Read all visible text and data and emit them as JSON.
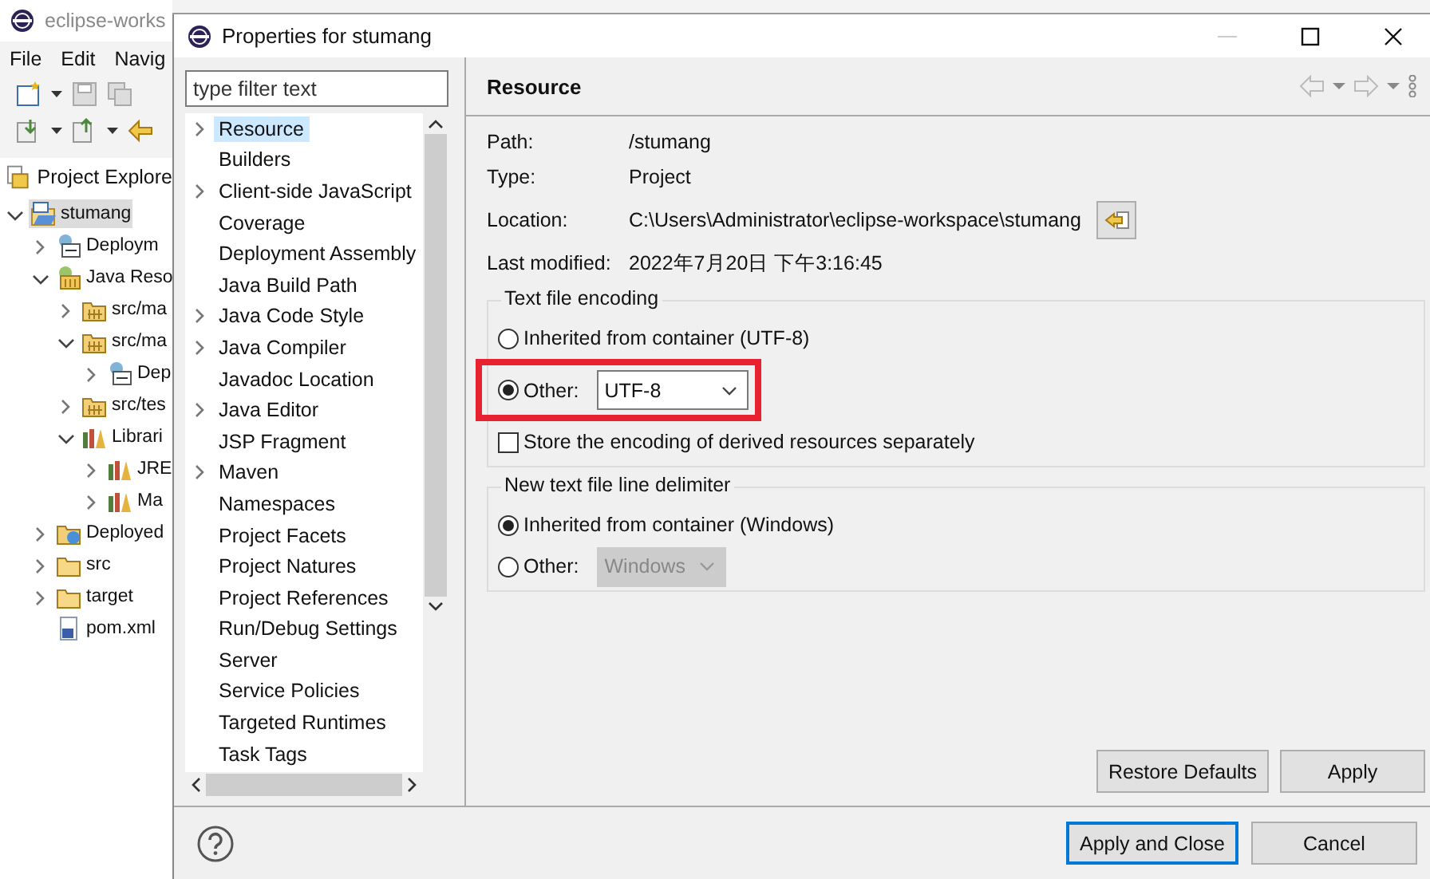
{
  "background_window": {
    "title": "eclipse-works",
    "menu": [
      "File",
      "Edit",
      "Navig"
    ],
    "view_tab": "Project Explore",
    "tree": [
      {
        "label": "stumang",
        "kind": "project",
        "expandable": true,
        "expanded": true,
        "selected": true,
        "children": [
          {
            "label": "Deploym",
            "kind": "descriptor",
            "expandable": true,
            "expanded": false,
            "selected": false
          },
          {
            "label": "Java Reso",
            "kind": "java-resources",
            "expandable": true,
            "expanded": true,
            "selected": false,
            "children": [
              {
                "label": "src/ma",
                "kind": "source-folder",
                "expandable": true,
                "expanded": false,
                "selected": false
              },
              {
                "label": "src/ma",
                "kind": "source-folder",
                "expandable": true,
                "expanded": true,
                "selected": false,
                "children": [
                  {
                    "label": "Dep",
                    "kind": "descriptor",
                    "expandable": true,
                    "expanded": false,
                    "selected": false
                  }
                ]
              },
              {
                "label": "src/tes",
                "kind": "source-folder",
                "expandable": true,
                "expanded": false,
                "selected": false
              },
              {
                "label": "Librari",
                "kind": "library",
                "expandable": true,
                "expanded": true,
                "selected": false,
                "children": [
                  {
                    "label": "JRE",
                    "kind": "library",
                    "expandable": true,
                    "expanded": false,
                    "selected": false
                  },
                  {
                    "label": "Ma",
                    "kind": "library",
                    "expandable": true,
                    "expanded": false,
                    "selected": false
                  }
                ]
              }
            ]
          },
          {
            "label": "Deployed",
            "kind": "web-deployed",
            "expandable": true,
            "expanded": false,
            "selected": false
          },
          {
            "label": "src",
            "kind": "folder",
            "expandable": true,
            "expanded": false,
            "selected": false
          },
          {
            "label": "target",
            "kind": "folder",
            "expandable": true,
            "expanded": false,
            "selected": false
          },
          {
            "label": "pom.xml",
            "kind": "xml-file",
            "expandable": false,
            "expanded": false,
            "selected": false
          }
        ]
      }
    ]
  },
  "dialog": {
    "title": "Properties for stumang",
    "filter": {
      "placeholder": "type filter text"
    },
    "pages": [
      {
        "label": "Resource",
        "expandable": true,
        "selected": true
      },
      {
        "label": "Builders",
        "expandable": false,
        "selected": false
      },
      {
        "label": "Client-side JavaScript",
        "expandable": true,
        "selected": false
      },
      {
        "label": "Coverage",
        "expandable": false,
        "selected": false
      },
      {
        "label": "Deployment Assembly",
        "expandable": false,
        "selected": false
      },
      {
        "label": "Java Build Path",
        "expandable": false,
        "selected": false
      },
      {
        "label": "Java Code Style",
        "expandable": true,
        "selected": false
      },
      {
        "label": "Java Compiler",
        "expandable": true,
        "selected": false
      },
      {
        "label": "Javadoc Location",
        "expandable": false,
        "selected": false
      },
      {
        "label": "Java Editor",
        "expandable": true,
        "selected": false
      },
      {
        "label": "JSP Fragment",
        "expandable": false,
        "selected": false
      },
      {
        "label": "Maven",
        "expandable": true,
        "selected": false
      },
      {
        "label": "Namespaces",
        "expandable": false,
        "selected": false
      },
      {
        "label": "Project Facets",
        "expandable": false,
        "selected": false
      },
      {
        "label": "Project Natures",
        "expandable": false,
        "selected": false
      },
      {
        "label": "Project References",
        "expandable": false,
        "selected": false
      },
      {
        "label": "Run/Debug Settings",
        "expandable": false,
        "selected": false
      },
      {
        "label": "Server",
        "expandable": false,
        "selected": false
      },
      {
        "label": "Service Policies",
        "expandable": false,
        "selected": false
      },
      {
        "label": "Targeted Runtimes",
        "expandable": false,
        "selected": false
      },
      {
        "label": "Task Tags",
        "expandable": false,
        "selected": false
      }
    ],
    "page_title": "Resource",
    "info": [
      {
        "label": "Path:",
        "value": "/stumang",
        "kind": "text"
      },
      {
        "label": "Type:",
        "value": "Project",
        "kind": "text"
      },
      {
        "label": "Location:",
        "value": "C:\\Users\\Administrator\\eclipse-workspace\\stumang",
        "kind": "with-button"
      },
      {
        "label": "Last modified:",
        "value": "2022年7月20日 下午3:16:45",
        "kind": "text"
      }
    ],
    "groups": [
      {
        "title": "Text file encoding",
        "options": [
          {
            "label": "Inherited from container (UTF-8)",
            "selected": false,
            "highlighted": false
          },
          {
            "label": "Other:",
            "selected": true,
            "value": "UTF-8",
            "disabled": false,
            "highlighted": true
          }
        ],
        "checkbox": {
          "label": "Store the encoding of derived resources separately",
          "checked": false
        }
      },
      {
        "title": "New text file line delimiter",
        "options": [
          {
            "label": "Inherited from container (Windows)",
            "selected": true,
            "highlighted": false
          },
          {
            "label": "Other:",
            "selected": false,
            "value": "Windows",
            "disabled": true,
            "highlighted": false
          }
        ]
      }
    ],
    "page_buttons": [
      "Restore Defaults",
      "Apply"
    ],
    "footer_buttons": [
      {
        "label": "Apply and Close",
        "default": true
      },
      {
        "label": "Cancel",
        "default": false
      }
    ]
  }
}
